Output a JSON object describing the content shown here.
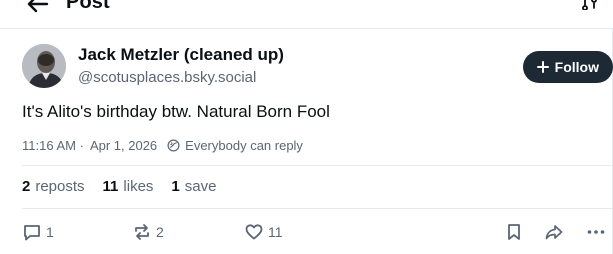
{
  "header": {
    "title": "Post",
    "back_icon": "arrow-left-icon",
    "settings_icon": "sliders-icon"
  },
  "post": {
    "author": {
      "display_name": "Jack Metzler (cleaned up)",
      "handle": "@scotusplaces.bsky.social",
      "avatar_icon": "avatar"
    },
    "follow_label": "Follow",
    "text": "It's Alito's birthday btw. Natural Born Fool",
    "time": "11:16 AM",
    "separator": "·",
    "date": "Apr 1, 2026",
    "reply_setting": "Everybody can reply",
    "stats": {
      "reposts_count": "2",
      "reposts_label": "reposts",
      "likes_count": "11",
      "likes_label": "likes",
      "saves_count": "1",
      "saves_label": "save"
    },
    "actions": {
      "reply_count": "1",
      "repost_count": "2",
      "like_count": "11"
    }
  },
  "colors": {
    "follow_bg": "#1e2936",
    "muted_text": "#5b6675",
    "primary_text": "#0b0f14",
    "divider": "#e6e9ee"
  }
}
